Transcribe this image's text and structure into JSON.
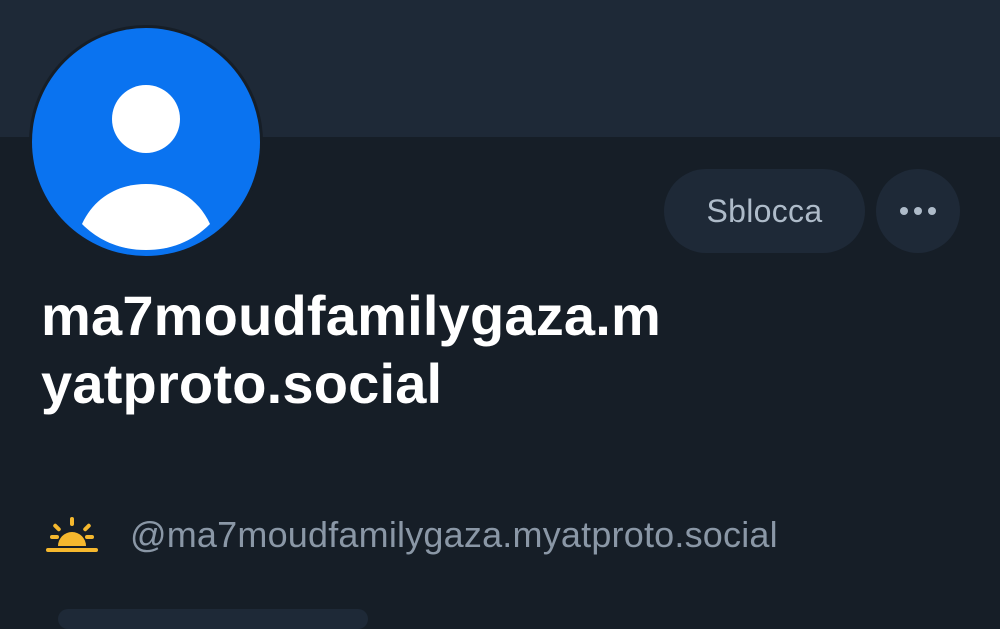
{
  "profile": {
    "display_name": "ma7moudfamilygaza.myatproto.social",
    "handle": "@ma7moudfamilygaza.myatproto.social",
    "avatar_icon": "default-user-avatar-icon",
    "handle_icon": "sunrise-icon"
  },
  "actions": {
    "unblock_label": "Sblocca",
    "more_icon": "ellipsis-icon"
  },
  "colors": {
    "background": "#161e27",
    "banner": "#1e2937",
    "avatar_blue": "#0a73f0",
    "button_bg": "#1e2937",
    "button_text": "#aebbc9",
    "handle_text": "#8a97a6",
    "sun_yellow": "#f5b82e"
  }
}
